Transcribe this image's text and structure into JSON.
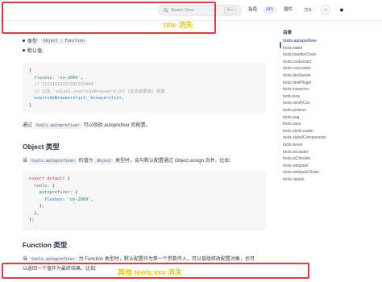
{
  "topbar": {
    "search_placeholder": "Search Docs",
    "search_shortcut": "⌘ K",
    "nav_guide": "指南",
    "nav_api": "API",
    "nav_plugins": "插件",
    "lang_icon_glyph": "文A",
    "theme_icon_glyph": "☼",
    "github_icon_glyph": "●"
  },
  "annotations": {
    "title_missing": "title 消失",
    "others_missing": "其他 tools.xxx 消失"
  },
  "content": {
    "type_label": "类型:",
    "type_value": "Object | Function",
    "default_label": "默认值:",
    "default_code": [
      [
        {
          "t": "{",
          "c": ""
        }
      ],
      [
        {
          "t": "  flexbox: ",
          "c": "c-key"
        },
        {
          "t": "'no-2009'",
          "c": "c-str"
        },
        {
          "t": ",",
          "c": ""
        }
      ],
      [
        {
          "t": "  // 11111122222333333444",
          "c": "c-com"
        }
      ],
      [
        {
          "t": "  // 以及 `output.overrideBrowserslist`(优先级更高) 配置",
          "c": "c-com"
        }
      ],
      [
        {
          "t": "  overrideBrowserslist: browserslist,",
          "c": "c-key"
        }
      ],
      [
        {
          "t": "}",
          "c": ""
        }
      ]
    ],
    "para1_prefix": "通过",
    "para1_code": "tools.autoprefixer",
    "para1_suffix": "可以修改 autoprefixer 的配置。",
    "h_object": "Object 类型",
    "para2_prefix": "当",
    "para2_code1": "tools.autoprefixer",
    "para2_mid": "的值为",
    "para2_code2": "Object",
    "para2_suffix": "类型时，会与默认配置通过 Object.assign 合并。比如:",
    "object_code": [
      [
        {
          "t": "export default",
          "c": "c-kw"
        },
        {
          "t": " {",
          "c": ""
        }
      ],
      [
        {
          "t": "  tools: ",
          "c": "c-key"
        },
        {
          "t": "{",
          "c": ""
        }
      ],
      [
        {
          "t": "    autoprefixer: ",
          "c": "c-key"
        },
        {
          "t": "{",
          "c": ""
        }
      ],
      [
        {
          "t": "      flexbox: ",
          "c": "c-key"
        },
        {
          "t": "'no-2009'",
          "c": "c-str"
        },
        {
          "t": ",",
          "c": ""
        }
      ],
      [
        {
          "t": "    },",
          "c": ""
        }
      ],
      [
        {
          "t": "  },",
          "c": ""
        }
      ],
      [
        {
          "t": "};",
          "c": ""
        }
      ]
    ],
    "h_function": "Function 类型",
    "para3_prefix": "当",
    "para3_code": "tools.autoprefixer",
    "para3_suffix": "为 Function 类型时，默认配置作为第一个参数传入，可以直接修改配置对象，也可",
    "para4": "以返回一个值作为最终结果。比如:"
  },
  "sidebar": {
    "title": "目录",
    "items": [
      "tools.autoprefixer",
      "tools.babel",
      "tools.bundlerChain",
      "tools.cssExtract",
      "tools.cssLoader",
      "tools.devServer",
      "tools.htmlPlugin",
      "tools.inspector",
      "tools.less",
      "tools.minifyCss",
      "tools.postcss",
      "tools.pug",
      "tools.sass",
      "tools.styleLoader",
      "tools.styledComponents",
      "tools.terser",
      "tools.tsLoader",
      "tools.tsChecker",
      "tools.webpack",
      "tools.webpackChain",
      "tools.rspack"
    ]
  },
  "colors": {
    "annotation_border": "#e83a3a",
    "annotation_text": "#e9c812",
    "accent": "#3a6bc2"
  }
}
